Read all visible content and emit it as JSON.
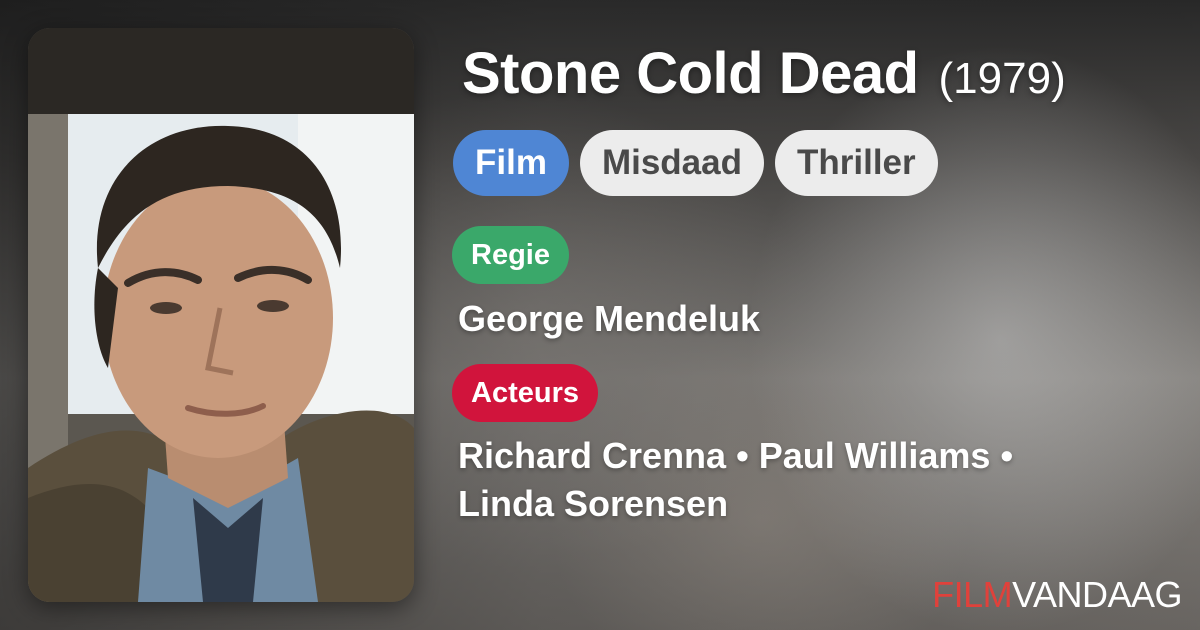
{
  "movie": {
    "title": "Stone Cold Dead",
    "year": "(1979)"
  },
  "genres": [
    "Film",
    "Misdaad",
    "Thriller"
  ],
  "director_section": {
    "label": "Regie",
    "names": "George Mendeluk"
  },
  "actors_section": {
    "label": "Acteurs",
    "names": [
      "Richard Crenna",
      "Paul Williams",
      "Linda Sorensen"
    ],
    "separator": "•"
  },
  "brand": {
    "part1": "FILM",
    "part2": "VANDAAG"
  },
  "colors": {
    "genre_primary": "#4f86d4",
    "genre_secondary": "#ececec",
    "director_label": "#3aa86a",
    "actors_label": "#d1143c",
    "brand_accent": "#e0413b"
  },
  "icons": {
    "poster": "movie-poster-image"
  }
}
